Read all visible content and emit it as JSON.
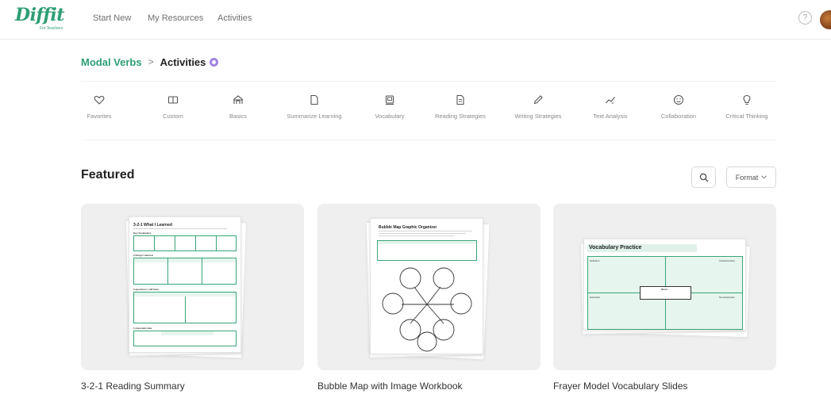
{
  "app": {
    "logo_text": "Diffit",
    "logo_subtext": "For Teachers"
  },
  "nav": {
    "items": [
      {
        "label": "Start New"
      },
      {
        "label": "My Resources"
      },
      {
        "label": "Activities"
      }
    ],
    "help_icon": "question-circle-icon"
  },
  "breadcrumb": {
    "parent": "Modal Verbs",
    "separator": ">",
    "current": "Activities"
  },
  "categories": [
    {
      "label": "Favorites",
      "icon": "heart-icon"
    },
    {
      "label": "Custom",
      "icon": "custom-icon"
    },
    {
      "label": "Basics",
      "icon": "basics-icon"
    },
    {
      "label": "Summarize Learning",
      "icon": "document-icon"
    },
    {
      "label": "Vocabulary",
      "icon": "vocabulary-icon"
    },
    {
      "label": "Reading Strategies",
      "icon": "reading-icon"
    },
    {
      "label": "Writing Strategies",
      "icon": "pencil-icon"
    },
    {
      "label": "Text Analysis",
      "icon": "sparkle-chart-icon"
    },
    {
      "label": "Collaboration",
      "icon": "smiley-icon"
    },
    {
      "label": "Critical Thinking",
      "icon": "lightbulb-icon"
    }
  ],
  "featured": {
    "title": "Featured",
    "format_label": "Format",
    "cards": [
      {
        "label": "3-2-1 Reading Summary",
        "sheet_title": "3-2-1 What I Learned",
        "sections": [
          "Key Vocabulary",
          "3 things I learned",
          "2 questions I still have",
          "1 important idea"
        ]
      },
      {
        "label": "Bubble Map with Image Workbook",
        "sheet_title": "Bubble Map Graphic Organizer"
      },
      {
        "label": "Frayer Model Vocabulary Slides",
        "sheet_title": "Vocabulary Practice",
        "quadrants": [
          "Definition",
          "Characteristics",
          "Examples",
          "Non-Examples"
        ],
        "center": "Word"
      }
    ]
  },
  "colors": {
    "brand": "#2d9e74",
    "accent_purple": "#a184e3",
    "muted_text": "#8a8a8a"
  }
}
